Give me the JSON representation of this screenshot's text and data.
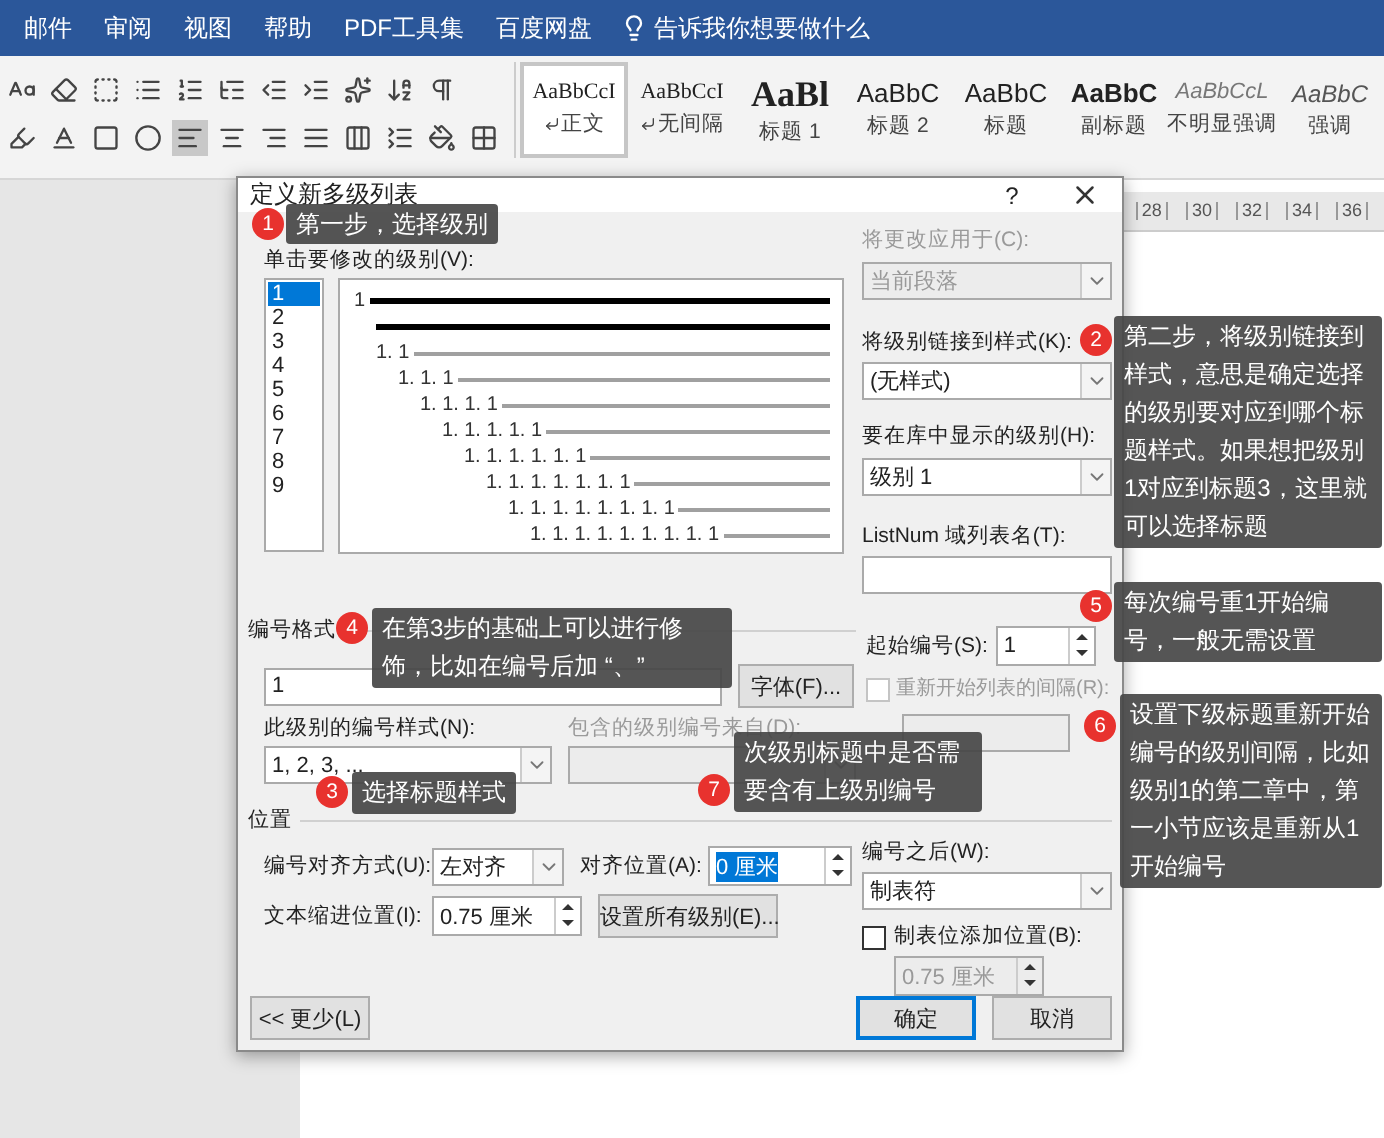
{
  "menu_tabs": [
    {
      "label": "邮件"
    },
    {
      "label": "审阅"
    },
    {
      "label": "视图"
    },
    {
      "label": "帮助"
    },
    {
      "label": "PDF工具集"
    },
    {
      "label": "百度网盘"
    }
  ],
  "tell_me": "告诉我你想要做什么",
  "styles": [
    {
      "sample": "AaBbCcI",
      "name": "正文",
      "kind": "normal",
      "mark": true,
      "selected": true
    },
    {
      "sample": "AaBbCcI",
      "name": "无间隔",
      "kind": "normal",
      "mark": true,
      "selected": false
    },
    {
      "sample": "AaBl",
      "name": "标题 1",
      "kind": "heading1",
      "mark": false,
      "selected": false
    },
    {
      "sample": "AaBbC",
      "name": "标题 2",
      "kind": "heading2",
      "mark": false,
      "selected": false
    },
    {
      "sample": "AaBbC",
      "name": "标题",
      "kind": "title",
      "mark": false,
      "selected": false
    },
    {
      "sample": "AaBbC",
      "name": "副标题",
      "kind": "strong",
      "mark": false,
      "selected": false
    },
    {
      "sample": "AaBbCcL",
      "name": "不明显强调",
      "kind": "subtle",
      "mark": false,
      "selected": false
    },
    {
      "sample": "AaBbC",
      "name": "强调",
      "kind": "emphasis",
      "mark": false,
      "selected": false
    }
  ],
  "ruler": [
    "28",
    "30",
    "32",
    "34",
    "36"
  ],
  "dialog": {
    "title": "定义新多级列表",
    "help": "?",
    "level_label": "单击要修改的级别(V):",
    "levels": [
      {
        "label": "1",
        "selected": true
      },
      {
        "label": "2",
        "selected": false
      },
      {
        "label": "3",
        "selected": false
      },
      {
        "label": "4",
        "selected": false
      },
      {
        "label": "5",
        "selected": false
      },
      {
        "label": "6",
        "selected": false
      },
      {
        "label": "7",
        "selected": false
      },
      {
        "label": "8",
        "selected": false
      },
      {
        "label": "9",
        "selected": false
      }
    ],
    "preview": [
      "1",
      "1. 1",
      "1. 1. 1",
      "1. 1. 1. 1",
      "1. 1. 1. 1. 1",
      "1. 1. 1. 1. 1. 1",
      "1. 1. 1. 1. 1. 1. 1",
      "1. 1. 1. 1. 1. 1. 1. 1",
      "1. 1. 1. 1. 1. 1. 1. 1. 1"
    ],
    "apply_to": {
      "label": "将更改应用于(C):",
      "value": "当前段落",
      "disabled": true
    },
    "link_style": {
      "label": "将级别链接到样式(K):",
      "value": "(无样式)",
      "disabled": false
    },
    "gallery_level": {
      "label": "要在库中显示的级别(H):",
      "value": "级别 1",
      "disabled": false
    },
    "listnum": {
      "label": "ListNum 域列表名(T):"
    },
    "number_format": {
      "heading": "编号格式",
      "format_value": "1",
      "font_button": "字体(F)...",
      "style_label": "此级别的编号样式(N):",
      "style_value": "1, 2, 3, ...",
      "include_label": "包含的级别编号来自(D):",
      "include_disabled": true,
      "start_label": "起始编号(S):",
      "start_value": "1",
      "restart": {
        "label": "重新开始列表的间隔(R):",
        "checked": false,
        "disabled": true
      }
    },
    "position": {
      "heading": "位置",
      "align_label": "编号对齐方式(U):",
      "align_value": "左对齐",
      "at_label": "对齐位置(A):",
      "at_value": "0 厘米",
      "at_selected": true,
      "indent_label": "文本缩进位置(I):",
      "indent_value": "0.75 厘米",
      "all_levels_button": "设置所有级别(E)...",
      "follow_label": "编号之后(W):",
      "follow_value": "制表符",
      "tab_stop": {
        "label": "制表位添加位置(B):",
        "checked": false
      },
      "tab_value": "0.75 厘米",
      "tab_disabled": true
    },
    "buttons": [
      {
        "label": "<< 更少(L)",
        "default": false
      },
      {
        "label": "确定",
        "default": true
      },
      {
        "label": "取消",
        "default": false
      }
    ]
  },
  "callouts": [
    {
      "number": "1",
      "text": "第一步，选择级别"
    },
    {
      "number": "2",
      "text": "第二步，将级别链接到样式，意思是确定选择的级别要对应到哪个标题样式。如果想把级别1对应到标题3，这里就可以选择标题"
    },
    {
      "number": "4",
      "text": "在第3步的基础上可以进行修饰，比如在编号后加 “、”"
    },
    {
      "number": "5",
      "text": "每次编号重1开始编号，一般无需设置"
    },
    {
      "number": "3",
      "text": "选择标题样式"
    },
    {
      "number": "7",
      "text": "次级别标题中是否需要含有上级别编号"
    },
    {
      "number": "6",
      "text": "设置下级标题重新开始编号的级别间隔，比如级别1的第二章中，第一小节应该是重新从1开始编号"
    }
  ]
}
